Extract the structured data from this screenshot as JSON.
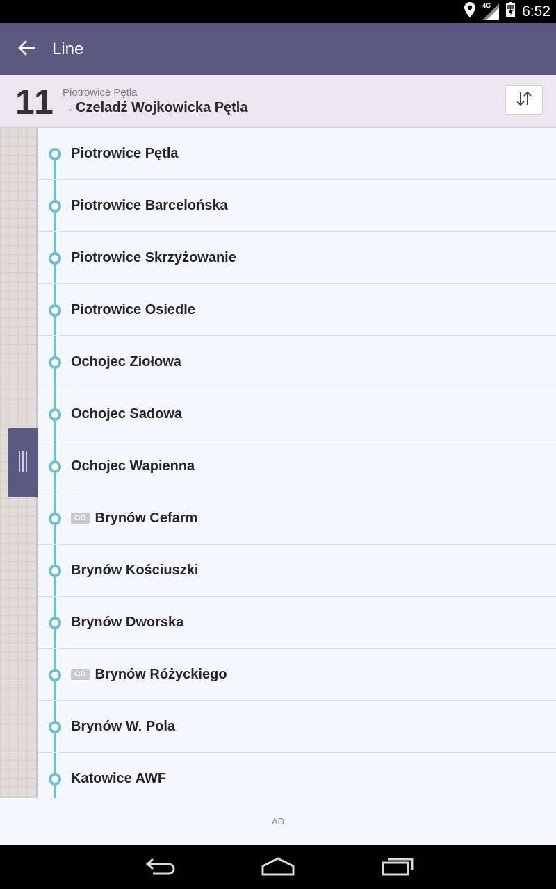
{
  "status_bar": {
    "time": "6:52",
    "network_label": "4G"
  },
  "app_bar": {
    "title": "Line"
  },
  "line_header": {
    "number": "11",
    "from": "Piotrowice Pętla",
    "to": "Czeladź Wojkowicka Pętla"
  },
  "stops": [
    {
      "name": "Piotrowice Pętla",
      "badge": ""
    },
    {
      "name": "Piotrowice Barcelońska",
      "badge": ""
    },
    {
      "name": "Piotrowice Skrzyżowanie",
      "badge": ""
    },
    {
      "name": "Piotrowice Osiedle",
      "badge": ""
    },
    {
      "name": "Ochojec Ziołowa",
      "badge": ""
    },
    {
      "name": "Ochojec Sadowa",
      "badge": ""
    },
    {
      "name": "Ochojec Wapienna",
      "badge": ""
    },
    {
      "name": "Brynów Cefarm",
      "badge": "OD"
    },
    {
      "name": "Brynów Kościuszki",
      "badge": ""
    },
    {
      "name": "Brynów Dworska",
      "badge": ""
    },
    {
      "name": "Brynów Różyckiego",
      "badge": "OD"
    },
    {
      "name": "Brynów W. Pola",
      "badge": ""
    },
    {
      "name": "Katowice AWF",
      "badge": ""
    }
  ],
  "ad": {
    "label": "AD"
  },
  "colors": {
    "app_bar": "#5b5882",
    "route_line": "#6fbfd0",
    "header_bg": "#ece7ee"
  },
  "icons": {
    "status": [
      "location-icon",
      "signal-icon",
      "battery-icon"
    ],
    "app_bar": "back-arrow-icon",
    "swap": "swap-direction-icon",
    "drawer": "drawer-handle-icon",
    "nav": [
      "back-icon",
      "home-icon",
      "recent-apps-icon"
    ]
  }
}
